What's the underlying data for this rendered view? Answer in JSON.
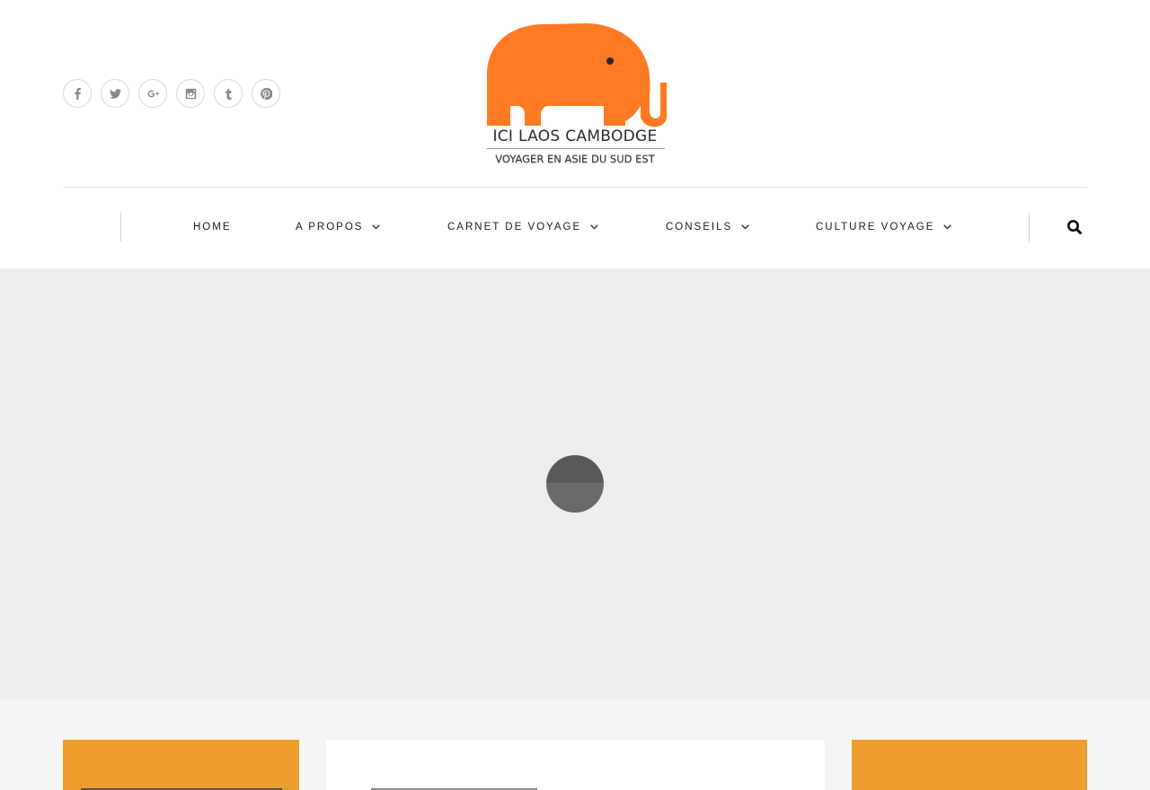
{
  "social": {
    "items": [
      {
        "name": "facebook-icon",
        "glyph": "f"
      },
      {
        "name": "twitter-icon",
        "glyph": "t"
      },
      {
        "name": "google-plus-icon",
        "glyph": "g+"
      },
      {
        "name": "instagram-icon",
        "glyph": "ig"
      },
      {
        "name": "tumblr-icon",
        "glyph": "t"
      },
      {
        "name": "pinterest-icon",
        "glyph": "p"
      }
    ]
  },
  "logo": {
    "title": "ICI LAOS CAMBODGE",
    "subtitle": "VOYAGER EN ASIE DU SUD EST",
    "icon": "elephant-icon",
    "brand_color": "#ff7a22"
  },
  "nav": {
    "items": [
      {
        "label": "HOME",
        "has_dropdown": false
      },
      {
        "label": "A PROPOS",
        "has_dropdown": true
      },
      {
        "label": "CARNET DE VOYAGE",
        "has_dropdown": true
      },
      {
        "label": "CONSEILS",
        "has_dropdown": true
      },
      {
        "label": "CULTURE VOYAGE",
        "has_dropdown": true
      }
    ],
    "search_icon": "search-icon"
  },
  "colors": {
    "accent_orange": "#ed9e2f",
    "hero_bg": "#ededed",
    "content_bg": "#f5f5f5"
  }
}
